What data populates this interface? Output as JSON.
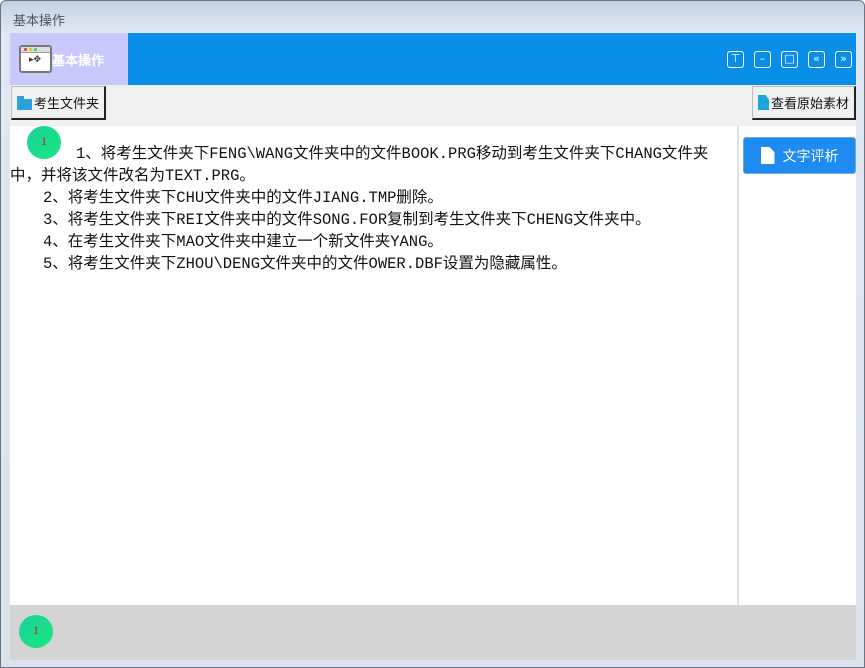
{
  "window": {
    "title": "基本操作"
  },
  "header": {
    "title": "基本操作",
    "buttons": [
      "pin",
      "minimize",
      "maximize",
      "previous",
      "next"
    ]
  },
  "toolbar": {
    "folder_label": "考生文件夹",
    "view_material_label": "查看原始素材"
  },
  "side": {
    "eval_label": "文字评析"
  },
  "badge": {
    "question_no": "1",
    "footer_no": "1"
  },
  "questions": [
    "1、将考生文件夹下FENG\\WANG文件夹中的文件BOOK.PRG移动到考生文件夹下CHANG文件夹中，并将该文件改名为TEXT.PRG。",
    "2、将考生文件夹下CHU文件夹中的文件JIANG.TMP删除。",
    "3、将考生文件夹下REI文件夹中的文件SONG.FOR复制到考生文件夹下CHENG文件夹中。",
    "4、在考生文件夹下MAO文件夹中建立一个新文件夹YANG。",
    "5、将考生文件夹下ZHOU\\DENG文件夹中的文件OWER.DBF设置为隐藏属性。"
  ]
}
